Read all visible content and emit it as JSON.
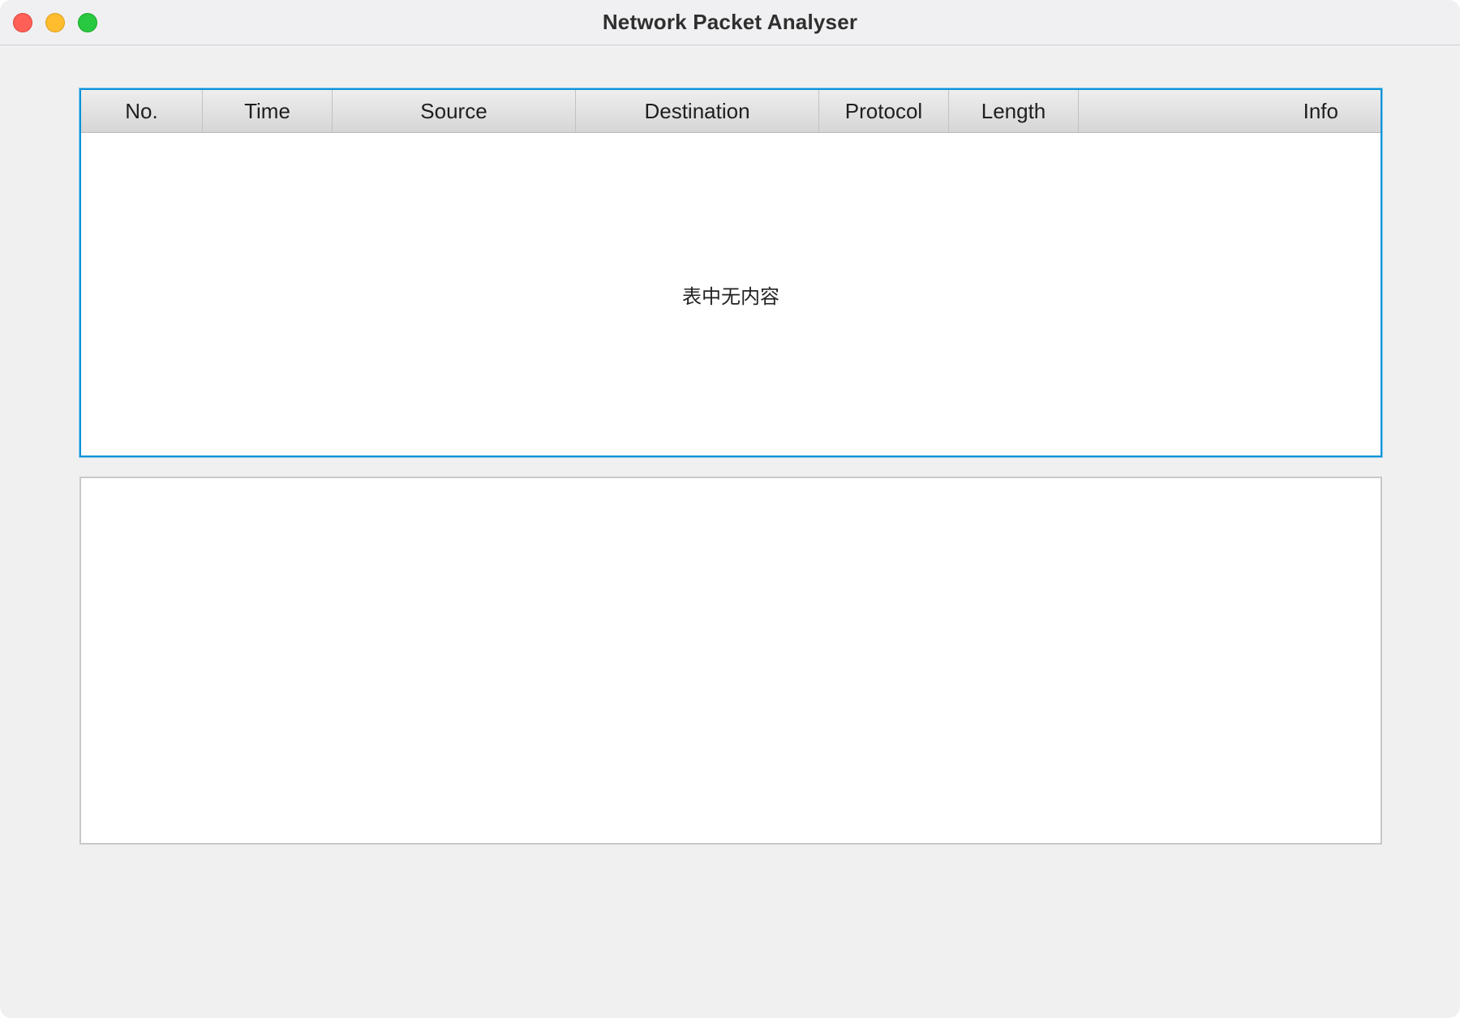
{
  "window": {
    "title": "Network Packet Analyser"
  },
  "packet_table": {
    "columns": [
      "No.",
      "Time",
      "Source",
      "Destination",
      "Protocol",
      "Length",
      "Info"
    ],
    "rows": [],
    "empty_placeholder": "表中无内容"
  },
  "packet_detail": {
    "text": ""
  },
  "colors": {
    "focus_border": "#0a93d8",
    "traffic_close": "#fe5f57",
    "traffic_minimize": "#febc2e",
    "traffic_zoom": "#28c840",
    "window_background": "#f0f0f0"
  }
}
